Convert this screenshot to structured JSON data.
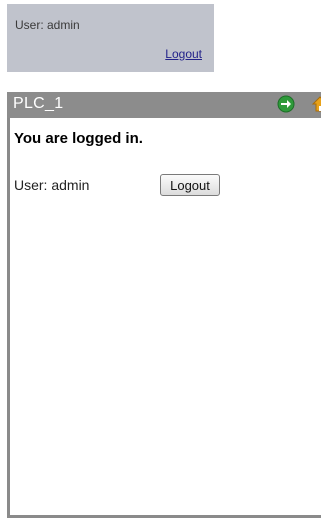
{
  "status_box": {
    "user_text": "User: admin",
    "logout_link": "Logout"
  },
  "panel": {
    "title": "PLC_1",
    "message": "You are logged in.",
    "user_text": "User: admin",
    "logout_button": "Logout"
  },
  "icons": {
    "next": "arrow-right-circle-icon",
    "home": "home-icon"
  },
  "colors": {
    "status_box_bg": "#c0c3cc",
    "header_bg": "#8c8c8c",
    "link": "#22228a",
    "next_icon": "#2e9a3a",
    "home_icon": "#e8a21a"
  }
}
